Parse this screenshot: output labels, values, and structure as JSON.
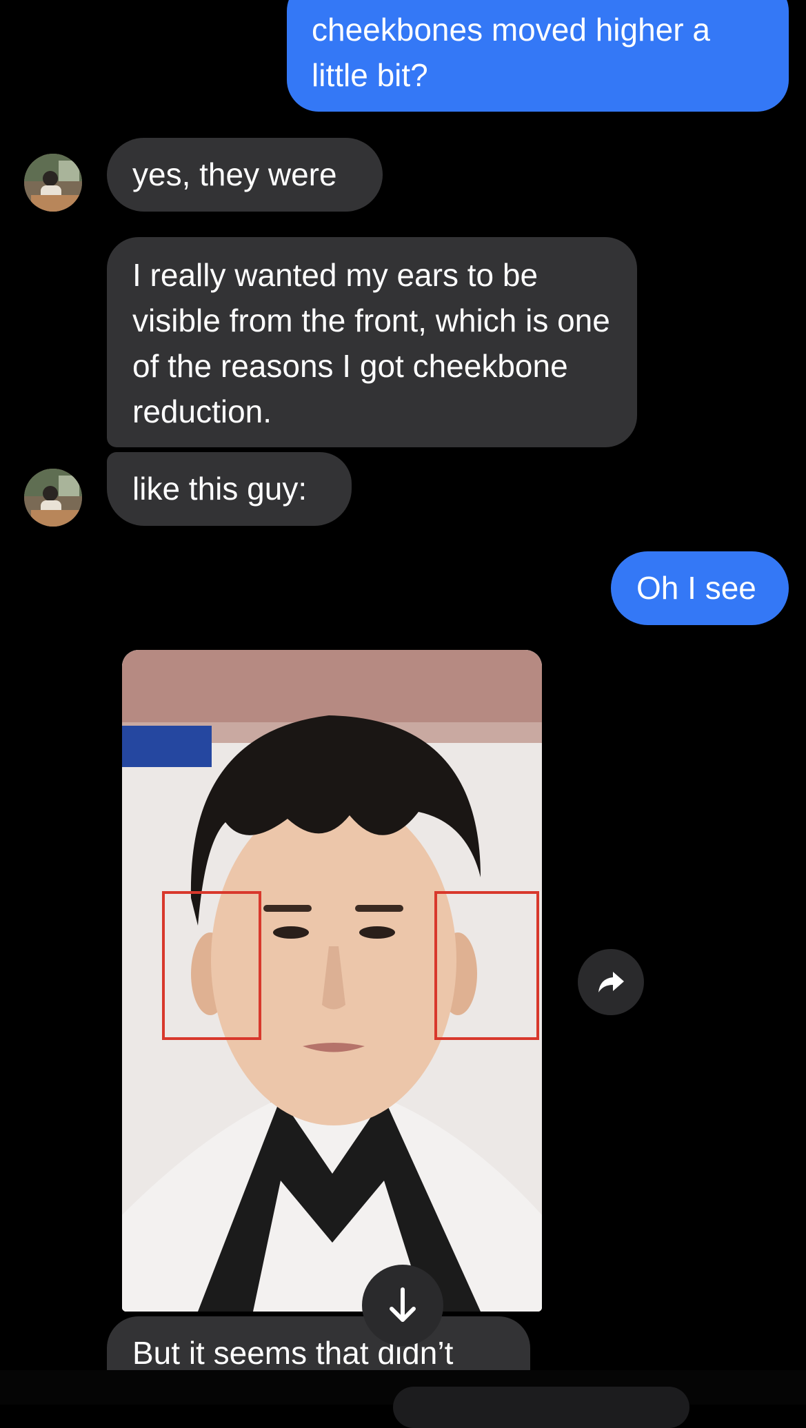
{
  "messages": [
    {
      "text": "cheekbones moved higher a little bit?"
    },
    {
      "text": "yes, they were"
    },
    {
      "text": "I really wanted my ears to be visible from the front, which is one of the reasons I got cheekbone reduction."
    },
    {
      "text": "like this guy:"
    },
    {
      "text": "Oh I see"
    },
    {
      "text": "But it seems that didn’t"
    }
  ],
  "icons": {
    "forward": "share-forward-icon",
    "scroll_down": "arrow-down-icon",
    "avatar": "contact-avatar"
  },
  "colors": {
    "background": "#000000",
    "outgoing_bubble": "#3478f6",
    "incoming_bubble": "#333335",
    "annotation_box": "#d8382c"
  }
}
